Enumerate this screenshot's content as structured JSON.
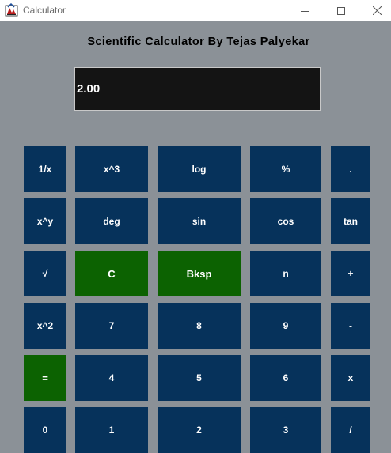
{
  "window": {
    "title": "Calculator"
  },
  "heading": "Scientific Calculator By Tejas Palyekar",
  "display": {
    "value": "2.00"
  },
  "colors": {
    "background": "#8b9197",
    "button": "#06325b",
    "button_accent": "#0c6201",
    "display": "#141414"
  },
  "buttons": [
    {
      "label": "1/x",
      "style": "blue"
    },
    {
      "label": "x^3",
      "style": "blue"
    },
    {
      "label": "log",
      "style": "blue"
    },
    {
      "label": "%",
      "style": "blue"
    },
    {
      "label": ".",
      "style": "blue"
    },
    {
      "label": "x^y",
      "style": "blue"
    },
    {
      "label": "deg",
      "style": "blue"
    },
    {
      "label": "sin",
      "style": "blue"
    },
    {
      "label": "cos",
      "style": "blue"
    },
    {
      "label": "tan",
      "style": "blue"
    },
    {
      "label": "√",
      "style": "blue"
    },
    {
      "label": "C",
      "style": "green"
    },
    {
      "label": "Bksp",
      "style": "green"
    },
    {
      "label": "n",
      "style": "blue"
    },
    {
      "label": "+",
      "style": "blue"
    },
    {
      "label": "x^2",
      "style": "blue"
    },
    {
      "label": "7",
      "style": "blue"
    },
    {
      "label": "8",
      "style": "blue"
    },
    {
      "label": "9",
      "style": "blue"
    },
    {
      "label": "-",
      "style": "blue"
    },
    {
      "label": "=",
      "style": "green"
    },
    {
      "label": "4",
      "style": "blue"
    },
    {
      "label": "5",
      "style": "blue"
    },
    {
      "label": "6",
      "style": "blue"
    },
    {
      "label": "x",
      "style": "blue"
    },
    {
      "label": "0",
      "style": "blue"
    },
    {
      "label": "1",
      "style": "blue"
    },
    {
      "label": "2",
      "style": "blue"
    },
    {
      "label": "3",
      "style": "blue"
    },
    {
      "label": "/",
      "style": "blue"
    }
  ]
}
